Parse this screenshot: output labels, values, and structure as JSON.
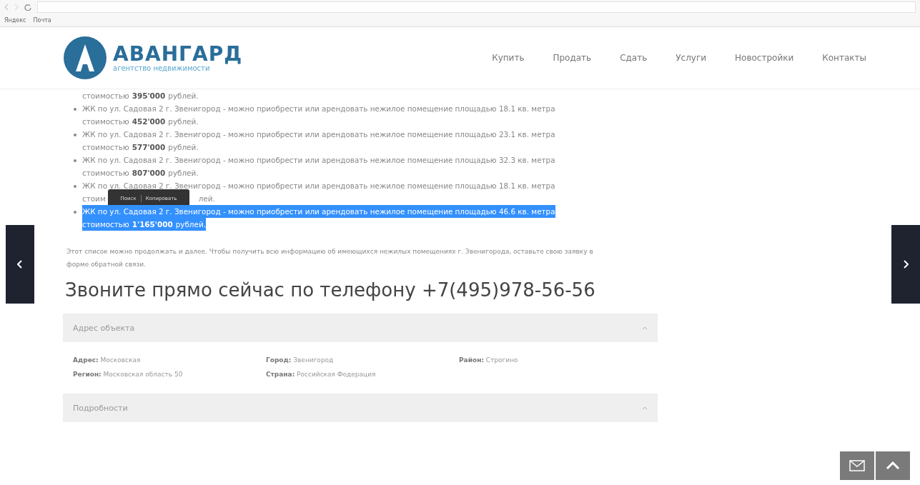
{
  "browser": {
    "bookmarks": [
      "Яндекс",
      "Почта"
    ]
  },
  "site": {
    "logo_name": "АВАНГАРД",
    "logo_tagline": "агентство недвижимости",
    "nav": [
      "Купить",
      "Продать",
      "Сдать",
      "Услуги",
      "Новостройки",
      "Контакты"
    ]
  },
  "listing": {
    "items": [
      {
        "kind": "tail",
        "price_label": "стоимостью",
        "price": "395'000",
        "unit": "рублей.",
        "selected": false
      },
      {
        "kind": "item",
        "text": "ЖК по ул. Садовая 2 г. Звенигород - можно приобрести или арендовать нежилое помещение  площадью 18.1  кв. метра",
        "price_label": "стоимостью",
        "price": "452'000",
        "unit": "рублей.",
        "selected": false
      },
      {
        "kind": "item",
        "text": "ЖК по ул. Садовая 2 г. Звенигород - можно приобрести или арендовать нежилое помещение  площадью 23.1  кв. метра",
        "price_label": "стоимостью",
        "price": "577'000",
        "unit": "рублей.",
        "selected": false
      },
      {
        "kind": "item",
        "text": "ЖК по ул. Садовая 2 г. Звенигород - можно приобрести или арендовать нежилое помещение  площадью 32.3  кв. метра",
        "price_label": "стоимостью",
        "price": "807'000",
        "unit": "рублей.",
        "selected": false
      },
      {
        "kind": "covered",
        "text": "ЖК по ул. Садовая 2 г. Звенигород - можно приобрести или арендовать нежилое помещение  площадью 18.1  кв. метра",
        "price_label": "стоим",
        "unit": "лей.",
        "selected": false
      },
      {
        "kind": "item",
        "text": "ЖК по ул. Садовая 2 г. Звенигород - можно приобрести или арендовать нежилое помещение  площадью 46.6 кв. метра",
        "price_label": "стоимостью",
        "price": "1'165'000",
        "unit": "рублей.",
        "selected": true
      }
    ],
    "popup": [
      "Поиск",
      "Копировать"
    ],
    "note": "Этот список можно продолжать и далее. Чтобы получить всю информацию об имеющихся нежилых помещениях  г. Звенигорода, оставьте свою заявку в форме обратной связи."
  },
  "call_heading": "Звоните прямо сейчас по телефону +7(495)978-56-56",
  "panels": [
    {
      "title": "Адрес объекта",
      "expanded": true,
      "fields": [
        {
          "label": "Адрес:",
          "value": "Московская"
        },
        {
          "label": "Город:",
          "value": "Звенигород"
        },
        {
          "label": "Район:",
          "value": "Строгино"
        },
        {
          "label": "Регион:",
          "value": "Московская область 50"
        },
        {
          "label": "Страна:",
          "value": "Российская Федерация"
        }
      ]
    },
    {
      "title": "Подробности",
      "expanded": true
    }
  ]
}
